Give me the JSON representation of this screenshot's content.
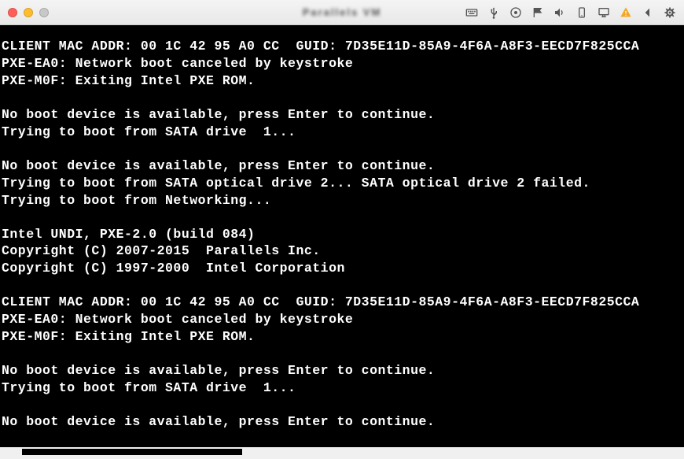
{
  "window": {
    "title": "Parallels VM"
  },
  "menubar": {
    "icons": [
      "keyboard-icon",
      "usb-icon",
      "disc-icon",
      "network-flag-icon",
      "sound-icon",
      "device-icon",
      "display-icon",
      "warning-icon",
      "back-icon",
      "settings-icon"
    ]
  },
  "terminal": {
    "lines": [
      "CLIENT MAC ADDR: 00 1C 42 95 A0 CC  GUID: 7D35E11D-85A9-4F6A-A8F3-EECD7F825CCA",
      "PXE-EA0: Network boot canceled by keystroke",
      "PXE-M0F: Exiting Intel PXE ROM.",
      "",
      "No boot device is available, press Enter to continue.",
      "Trying to boot from SATA drive  1...",
      "",
      "No boot device is available, press Enter to continue.",
      "Trying to boot from SATA optical drive 2... SATA optical drive 2 failed.",
      "Trying to boot from Networking...",
      "",
      "Intel UNDI, PXE-2.0 (build 084)",
      "Copyright (C) 2007-2015  Parallels Inc.",
      "Copyright (C) 1997-2000  Intel Corporation",
      "",
      "CLIENT MAC ADDR: 00 1C 42 95 A0 CC  GUID: 7D35E11D-85A9-4F6A-A8F3-EECD7F825CCA",
      "PXE-EA0: Network boot canceled by keystroke",
      "PXE-M0F: Exiting Intel PXE ROM.",
      "",
      "No boot device is available, press Enter to continue.",
      "Trying to boot from SATA drive  1...",
      "",
      "No boot device is available, press Enter to continue."
    ]
  }
}
